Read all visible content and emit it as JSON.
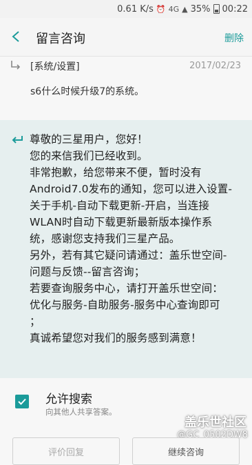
{
  "status_bar": {
    "speed": "0.61 K/s",
    "network": "4G",
    "battery": "35%",
    "time": "00:22"
  },
  "header": {
    "title": "留言咨询",
    "delete_label": "删除"
  },
  "question": {
    "category": "[系统/设置]",
    "date": "2017/02/23",
    "text": "s6什么时候升级7的系统。"
  },
  "answer": {
    "lines": [
      "尊敬的三星用户，您好！",
      "您的来信我们已经收到。",
      "非常抱歉，给您带来不便，暂时没有",
      "Android7.0发布的通知，您可以进入设置-",
      "关于手机-自动下载更新-开启，当连接",
      "WLAN时自动下载更新最新版本操作系",
      "统，感谢您支持我们三星产品。",
      "另外，若有其它疑问请通过：盖乐世空间-",
      "问题与反馈--留言咨询；",
      "若要查询服务中心，请打开盖乐世空间：",
      "优化与服务-自助服务-服务中心查询即可",
      "；",
      "真诚希望您对我们的服务感到满意！"
    ]
  },
  "search_option": {
    "title": "允许搜索",
    "subtitle": "向其他人共享答案。",
    "checked": true
  },
  "watermark": {
    "brand": "盖乐世社区",
    "user": "@GC_0502DW8"
  },
  "buttons": {
    "evaluate": "评价回复",
    "continue": "继续咨询"
  },
  "colors": {
    "accent": "#1b9b9a",
    "answer_bg": "#e6efef"
  }
}
